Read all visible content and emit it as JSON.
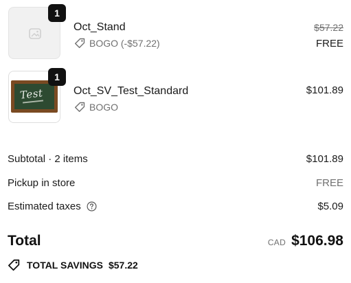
{
  "items": [
    {
      "name": "Oct_Stand",
      "quantity": "1",
      "discount": "BOGO (-$57.22)",
      "original_price": "$57.22",
      "price": "FREE",
      "image": "placeholder-image-icon"
    },
    {
      "name": "Oct_SV_Test_Standard",
      "quantity": "1",
      "discount": "BOGO",
      "price": "$101.89",
      "image": "chalkboard-test-image",
      "image_text": "Test"
    }
  ],
  "summary": {
    "subtotal_label": "Subtotal · 2 items",
    "subtotal_value": "$101.89",
    "shipping_label": "Pickup in store",
    "shipping_value": "FREE",
    "taxes_label": "Estimated taxes",
    "taxes_value": "$5.09"
  },
  "total": {
    "label": "Total",
    "currency": "CAD",
    "amount": "$106.98"
  },
  "savings": {
    "label": "TOTAL SAVINGS",
    "amount": "$57.22"
  },
  "icons": {
    "discount": "tag-icon",
    "help": "question-circle-icon"
  },
  "colors": {
    "badge": "#111111",
    "muted_text": "#707070",
    "text": "#1a1a1a"
  }
}
